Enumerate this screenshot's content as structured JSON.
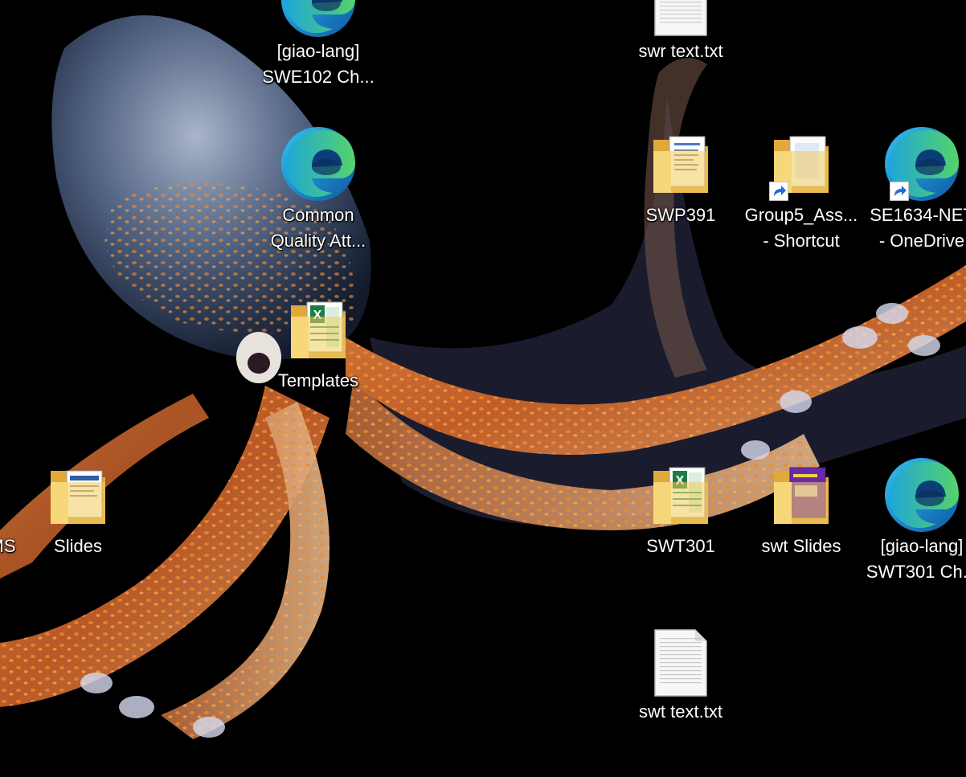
{
  "desktop": {
    "wallpaper": "octopus-wallpaper",
    "icons": [
      {
        "id": "giao-swe102",
        "type": "edge",
        "shortcut": false,
        "line1": "[giao-lang]",
        "line2": "SWE102 Ch..."
      },
      {
        "id": "swr-text",
        "type": "text-file",
        "shortcut": false,
        "line1": "swr text.txt",
        "line2": ""
      },
      {
        "id": "common-quality",
        "type": "edge",
        "shortcut": false,
        "line1": "Common",
        "line2": "Quality Att..."
      },
      {
        "id": "swp391",
        "type": "folder-doc",
        "shortcut": false,
        "line1": "SWP391",
        "line2": ""
      },
      {
        "id": "group5",
        "type": "folder-plain",
        "shortcut": true,
        "line1": "Group5_Ass...",
        "line2": "- Shortcut"
      },
      {
        "id": "se1634",
        "type": "edge",
        "shortcut": true,
        "line1": "SE1634-NET",
        "line2": "- OneDrive"
      },
      {
        "id": "templates",
        "type": "folder-excel",
        "shortcut": false,
        "line1": "Templates",
        "line2": ""
      },
      {
        "id": "ms-cut",
        "type": "none",
        "shortcut": false,
        "line1": "MS",
        "line2": ""
      },
      {
        "id": "slides",
        "type": "folder-slides",
        "shortcut": false,
        "line1": "Slides",
        "line2": ""
      },
      {
        "id": "swt301",
        "type": "folder-excel",
        "shortcut": false,
        "line1": "SWT301",
        "line2": ""
      },
      {
        "id": "swt-slides",
        "type": "folder-purple",
        "shortcut": false,
        "line1": "swt Slides",
        "line2": ""
      },
      {
        "id": "giao-swt301",
        "type": "edge",
        "shortcut": false,
        "line1": "[giao-lang]",
        "line2": "SWT301 Ch..."
      },
      {
        "id": "swt-text",
        "type": "text-file",
        "shortcut": false,
        "line1": "swt text.txt",
        "line2": ""
      }
    ]
  }
}
